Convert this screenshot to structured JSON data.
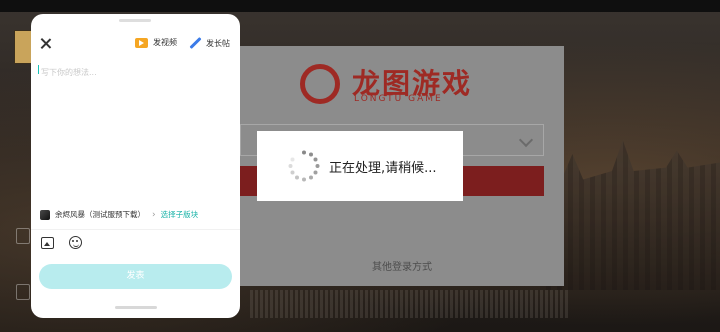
{
  "compose": {
    "video_label": "发视频",
    "long_post_label": "发长帖",
    "placeholder": "写下你的想法...",
    "forum_name": "余烬风暴（测试服预下载）",
    "subforum_link": "选择子版块",
    "publish_label": "发表"
  },
  "login": {
    "logo_title": "龙图游戏",
    "logo_subtitle": "LONGTU GAME",
    "other_login": "其他登录方式"
  },
  "loading": {
    "text": "正在处理,请稍候..."
  },
  "colors": {
    "accent": "#19b3a8",
    "publish_disabled": "#b8ecee",
    "video_icon": "#f5a623",
    "pen_icon": "#3b7be8",
    "brand_red": "#9e2a24"
  }
}
